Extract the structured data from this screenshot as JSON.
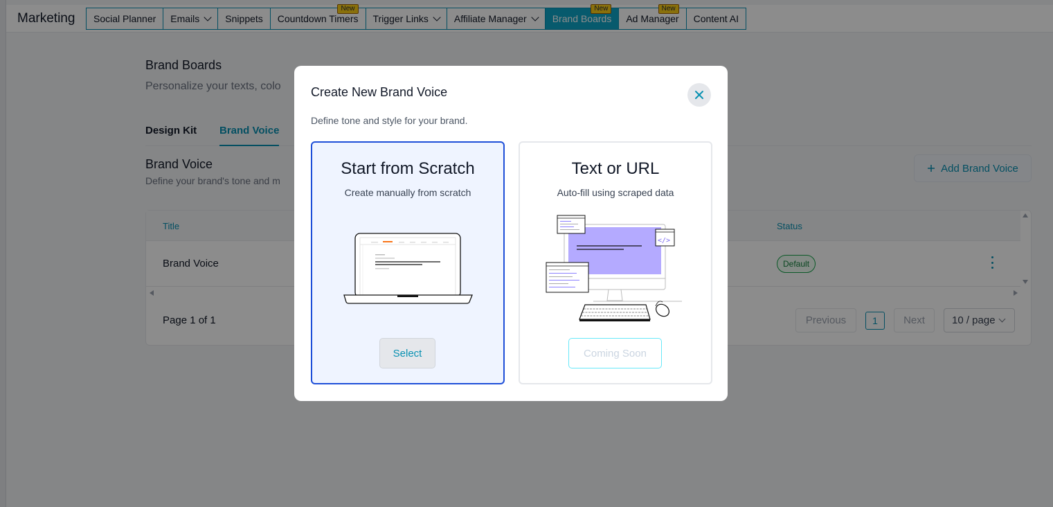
{
  "app": {
    "title": "Marketing"
  },
  "nav": {
    "tabs": [
      {
        "label": "Social Planner",
        "dropdown": false,
        "new": false,
        "active": false
      },
      {
        "label": "Emails",
        "dropdown": true,
        "new": false,
        "active": false
      },
      {
        "label": "Snippets",
        "dropdown": false,
        "new": false,
        "active": false
      },
      {
        "label": "Countdown Timers",
        "dropdown": false,
        "new": true,
        "active": false
      },
      {
        "label": "Trigger Links",
        "dropdown": true,
        "new": false,
        "active": false
      },
      {
        "label": "Affiliate Manager",
        "dropdown": true,
        "new": false,
        "active": false
      },
      {
        "label": "Brand Boards",
        "dropdown": false,
        "new": true,
        "active": true
      },
      {
        "label": "Ad Manager",
        "dropdown": false,
        "new": true,
        "active": false
      },
      {
        "label": "Content AI",
        "dropdown": false,
        "new": false,
        "active": false
      }
    ],
    "new_badge": "New"
  },
  "page": {
    "title": "Brand Boards",
    "subtitle": "Personalize your texts, colo",
    "tabs": {
      "design_kit": "Design Kit",
      "brand_voice": "Brand Voice"
    },
    "section_title": "Brand Voice",
    "section_subtitle": "Define your brand's tone and m",
    "add_button": "Add Brand Voice"
  },
  "table": {
    "columns": {
      "title": "Title",
      "status": "Status"
    },
    "rows": [
      {
        "title": "Brand Voice",
        "status": "Default"
      }
    ],
    "pagination": {
      "info": "Page 1 of 1",
      "previous": "Previous",
      "current": "1",
      "next": "Next",
      "page_size": "10 / page"
    }
  },
  "modal": {
    "title": "Create New Brand Voice",
    "subtitle": "Define tone and style for your brand.",
    "options": {
      "scratch": {
        "title": "Start from Scratch",
        "subtitle": "Create manually from scratch",
        "button": "Select"
      },
      "url": {
        "title": "Text or URL",
        "subtitle": "Auto-fill using scraped data",
        "button": "Coming Soon"
      }
    }
  },
  "colors": {
    "accent": "#0891b2",
    "active_tab": "#0ea5c6",
    "selected_border": "#1d4ed8",
    "illustration": "#b4aaff"
  },
  "icons": {
    "close": "close-icon",
    "add": "plus-icon",
    "more": "kebab-icon"
  }
}
